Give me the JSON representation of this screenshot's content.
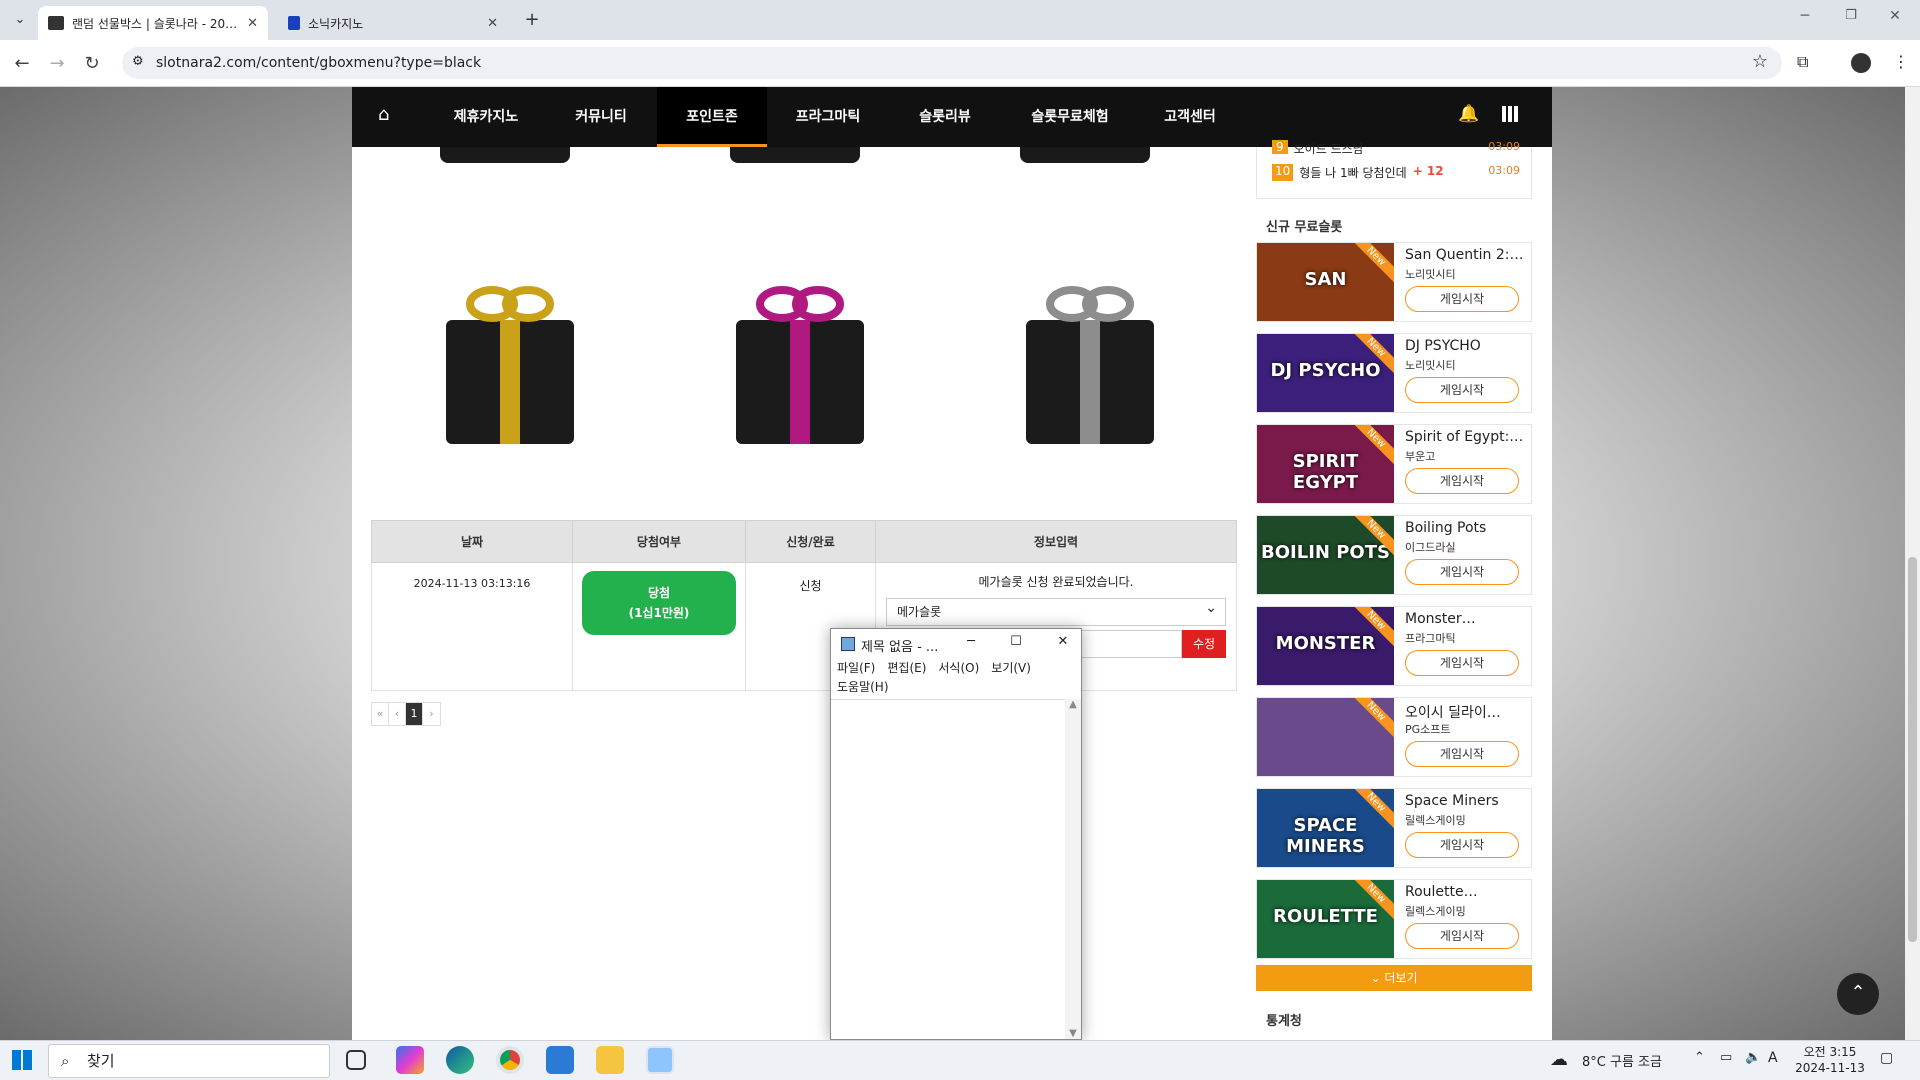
{
  "browser": {
    "tabs": [
      {
        "title": "랜덤 선물박스 | 슬롯나라 - 20…"
      },
      {
        "title": "소닉카지노"
      }
    ],
    "url": "slotnara2.com/content/gboxmenu?type=black"
  },
  "site": {
    "nav": [
      "제휴카지노",
      "커뮤니티",
      "포인트존",
      "프라그마틱",
      "슬롯리뷰",
      "슬롯무료체험",
      "고객센터"
    ],
    "active_nav": "포인트존",
    "gift_colors": [
      "#c9a21a",
      "#b0197f",
      "#8d8d8d"
    ],
    "table": {
      "headers": [
        "날짜",
        "당첨여부",
        "신청/완료",
        "정보입력"
      ],
      "row": {
        "date": "2024-11-13 03:13:16",
        "result_line1": "당첨",
        "result_line2": "(1십1만원)",
        "status": "신청",
        "info_msg": "메가슬롯 신청 완료되었습니다.",
        "select_value": "메가슬롯",
        "edit_button": "수정"
      }
    },
    "pager": {
      "first": "«",
      "prev": "‹",
      "current": "1",
      "next": "›"
    },
    "ranking_tail": [
      {
        "rank": "9",
        "text": "오이드 드스남",
        "time": "03:09"
      },
      {
        "rank": "10",
        "text": "형들 나 1빠 당첨인데",
        "count": "+ 12",
        "time": "03:09"
      }
    ],
    "sidebar_title": "신규 무료슬롯",
    "games": [
      {
        "name": "San Quentin 2:…",
        "provider": "노리밋시티",
        "thumb_text": "SAN",
        "color": "#8a3a14"
      },
      {
        "name": "DJ PSYCHO",
        "provider": "노리밋시티",
        "thumb_text": "DJ PSYCHO",
        "color": "#3b1f7a"
      },
      {
        "name": "Spirit of Egypt:…",
        "provider": "부운고",
        "thumb_text": "SPIRIT EGYPT",
        "color": "#7a1a4a"
      },
      {
        "name": "Boiling Pots",
        "provider": "이그드라실",
        "thumb_text": "BOILIN POTS",
        "color": "#1f4a2a"
      },
      {
        "name": "Monster…",
        "provider": "프라그마틱",
        "thumb_text": "MONSTER",
        "color": "#3a1a6a"
      },
      {
        "name": "오이시 딜라이…",
        "provider": "PG소프트",
        "thumb_text": "",
        "color": "#6a4a8a"
      },
      {
        "name": "Space Miners",
        "provider": "릴렉스게이밍",
        "thumb_text": "SPACE MINERS",
        "color": "#1a4a8a"
      },
      {
        "name": "Roulette…",
        "provider": "릴렉스게이밍",
        "thumb_text": "ROULETTE",
        "color": "#1a6a3a"
      }
    ],
    "play_label": "게임시작",
    "new_label": "New",
    "more_label": "⌄ 더보기",
    "stats_title": "통계청"
  },
  "notepad": {
    "title": "제목 없음 - ...",
    "menu": [
      "파일(F)",
      "편집(E)",
      "서식(O)",
      "보기(V)",
      "도움말(H)"
    ]
  },
  "taskbar": {
    "search_placeholder": "찾기",
    "weather": "8°C 구름 조금",
    "time": "오전 3:15",
    "date": "2024-11-13",
    "ime": "A"
  }
}
